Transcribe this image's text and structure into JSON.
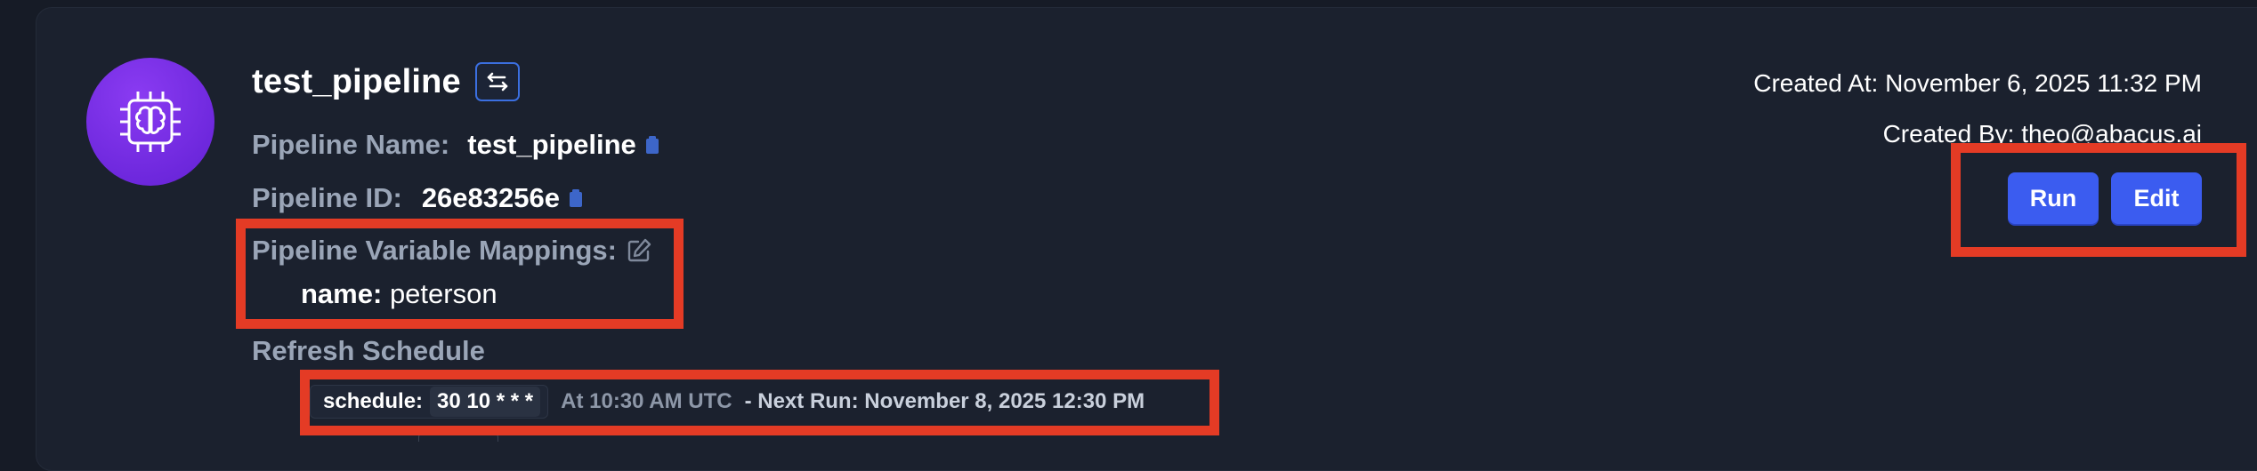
{
  "pipeline": {
    "title": "test_pipeline",
    "name_label": "Pipeline Name:",
    "name_value": "test_pipeline",
    "id_label": "Pipeline ID:",
    "id_value": "26e83256e",
    "mappings_label": "Pipeline Variable Mappings:",
    "mapping_key": "name:",
    "mapping_value": "peterson",
    "refresh_label": "Refresh Schedule"
  },
  "schedule": {
    "tag": "schedule:",
    "cron": "30 10 * * *",
    "human": "At 10:30 AM UTC",
    "next_run": "- Next Run: November 8, 2025 12:30 PM"
  },
  "meta": {
    "created_at": "Created At: November 6, 2025 11:32 PM",
    "created_by": "Created By: theo@abacus.ai"
  },
  "actions": {
    "run_label": "Run",
    "edit_label": "Edit"
  },
  "colors": {
    "accent": "#3b5cf0",
    "highlight": "#e43b25",
    "avatar": "#7a2fe8"
  },
  "icons": {
    "avatar": "chip-brain-icon",
    "pipeline_toggle": "swap-arrows-icon",
    "copy": "clipboard-icon",
    "edit": "edit-pencil-icon"
  }
}
